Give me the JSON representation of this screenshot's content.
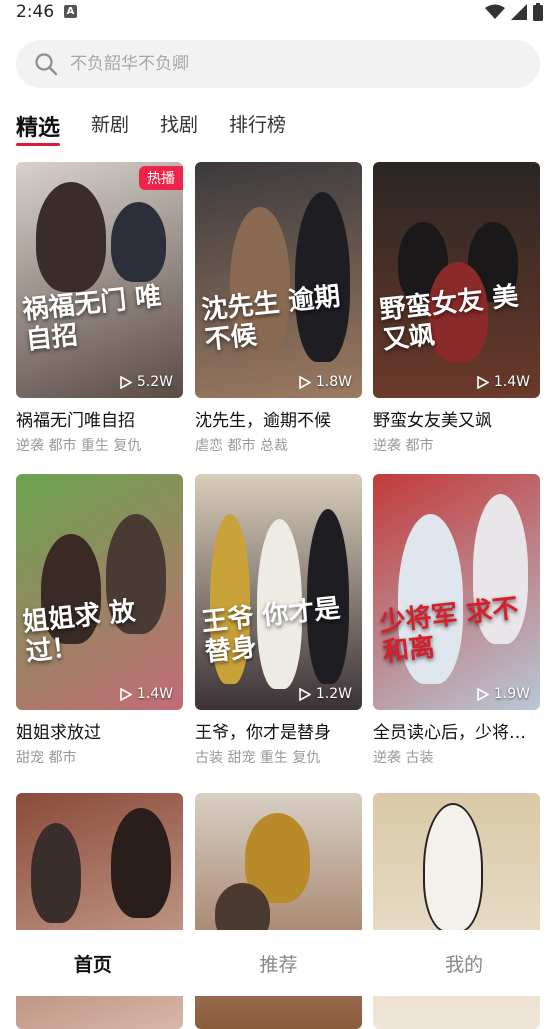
{
  "status": {
    "time": "2:46",
    "a_icon": "A"
  },
  "search": {
    "placeholder": "不负韶华不负卿"
  },
  "tabs": [
    {
      "label": "精选",
      "active": true
    },
    {
      "label": "新剧",
      "active": false
    },
    {
      "label": "找剧",
      "active": false
    },
    {
      "label": "排行榜",
      "active": false
    }
  ],
  "cards": [
    {
      "title": "祸福无门唯自招",
      "tags": "逆袭 都市 重生 复仇",
      "views": "5.2W",
      "badge": "热播",
      "poster_text": "祸福无门 唯自招",
      "colors": [
        "#c9c3bd",
        "#5a4a44"
      ]
    },
    {
      "title": "沈先生，逾期不候",
      "tags": "虐恋 都市 总裁",
      "views": "1.8W",
      "badge": "",
      "poster_text": "沈先生 逾期不候",
      "colors": [
        "#3c3a3d",
        "#9b7a61"
      ]
    },
    {
      "title": "野蛮女友美又飒",
      "tags": "逆袭 都市",
      "views": "1.4W",
      "badge": "",
      "poster_text": "野蛮女友 美又飒",
      "colors": [
        "#2a2624",
        "#6b3a2a"
      ]
    },
    {
      "title": "姐姐求放过",
      "tags": "甜宠 都市",
      "views": "1.4W",
      "badge": "",
      "poster_text": "姐姐求 放过！",
      "colors": [
        "#6aa34e",
        "#c36b76"
      ]
    },
    {
      "title": "王爷，你才是替身",
      "tags": "古装 甜宠 重生 复仇",
      "views": "1.2W",
      "badge": "",
      "poster_text": "王爷 你才是替身",
      "colors": [
        "#d8cdb9",
        "#3b3236"
      ]
    },
    {
      "title": "全员读心后，少将军和离不成",
      "tags": "逆袭 古装",
      "views": "1.9W",
      "badge": "",
      "poster_text": "少将军 求不和离",
      "colors": [
        "#c23a3a",
        "#b8c8d6"
      ]
    },
    {
      "title": "",
      "tags": "",
      "views": "",
      "badge": "",
      "poster_text": "",
      "colors": [
        "#8a4a3a",
        "#d8b8a8"
      ]
    },
    {
      "title": "",
      "tags": "",
      "views": "",
      "badge": "",
      "poster_text": "",
      "colors": [
        "#d8cfc4",
        "#8b5a3b"
      ]
    },
    {
      "title": "",
      "tags": "",
      "views": "",
      "badge": "",
      "poster_text": "",
      "colors": [
        "#d9c9a8",
        "#f0e6d8"
      ]
    }
  ],
  "bottom_nav": [
    {
      "label": "首页",
      "active": true
    },
    {
      "label": "推荐",
      "active": false
    },
    {
      "label": "我的",
      "active": false
    }
  ],
  "icons": {
    "search": "search-icon",
    "play": "play-icon",
    "wifi": "wifi-icon",
    "signal": "signal-icon",
    "battery": "battery-icon"
  },
  "accent": "#e0193a"
}
